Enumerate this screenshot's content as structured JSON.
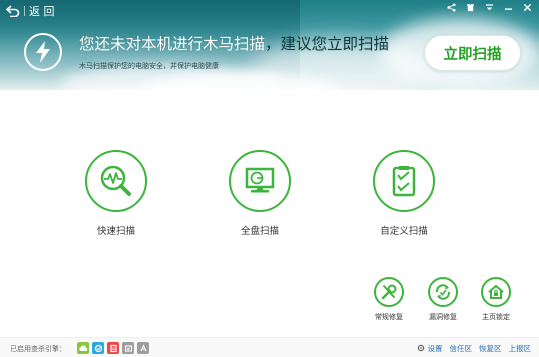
{
  "header": {
    "back_label": "返 回",
    "headline_a": "您还未对本机进行木马扫描",
    "headline_b": "，建议您立即扫描",
    "subline": "木马扫描保护您的电脑安全，并保护电脑健康",
    "scan_now_label": "立即扫描"
  },
  "scan_options": [
    {
      "label": "快速扫描",
      "icon": "quick-scan-icon"
    },
    {
      "label": "全盘扫描",
      "icon": "full-scan-icon"
    },
    {
      "label": "自定义扫描",
      "icon": "custom-scan-icon"
    }
  ],
  "tools": [
    {
      "label": "常规修复",
      "icon": "wrench-icon"
    },
    {
      "label": "漏洞修复",
      "icon": "vulnerability-icon"
    },
    {
      "label": "主页锁定",
      "icon": "home-lock-icon"
    }
  ],
  "footer": {
    "engine_label": "已启用查杀引擎：",
    "engines": [
      {
        "name": "cloud-engine-icon",
        "color": "#8cc63f"
      },
      {
        "name": "qvm-engine-icon",
        "color": "#2fa8e0"
      },
      {
        "name": "bitdefender-engine-icon",
        "color": "#e84a4a"
      },
      {
        "name": "system-repair-engine-icon",
        "color": "#9e9e9e"
      },
      {
        "name": "avira-engine-icon",
        "color": "#9e9e9e"
      }
    ],
    "links": [
      "设置",
      "信任区",
      "恢复区",
      "上报区"
    ]
  },
  "colors": {
    "accent": "#3db43d",
    "link": "#2a6fb8"
  }
}
